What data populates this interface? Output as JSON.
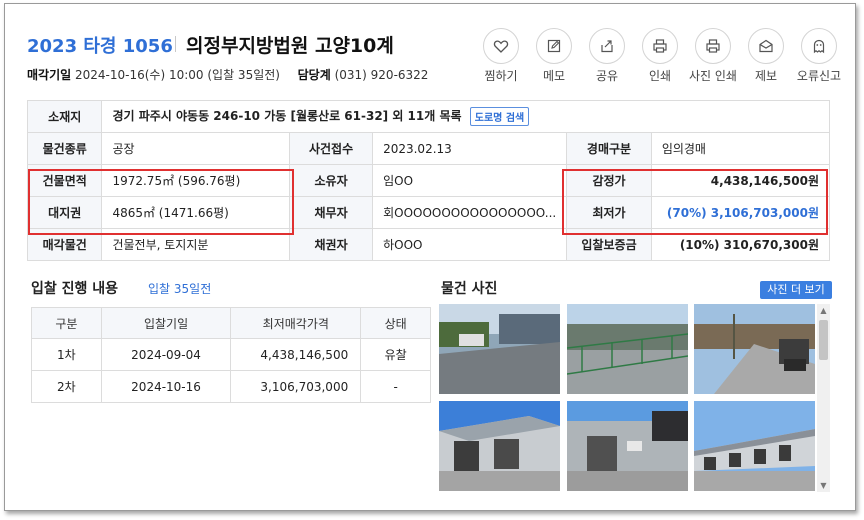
{
  "header": {
    "case_no": "2023 타경 1056",
    "court": "의정부지방법원 고양10계",
    "sale_date_label": "매각기일",
    "sale_date_value": "2024-10-16(수) 10:00 (입찰 35일전)",
    "manager_label": "담당계",
    "manager_value": "(031) 920-6322"
  },
  "actions": [
    {
      "label": "찜하기",
      "icon": "heart-icon"
    },
    {
      "label": "메모",
      "icon": "pencil-icon"
    },
    {
      "label": "공유",
      "icon": "share-icon"
    },
    {
      "label": "인쇄",
      "icon": "print-icon"
    },
    {
      "label": "사진 인쇄",
      "icon": "print-icon"
    },
    {
      "label": "제보",
      "icon": "envelope-icon"
    },
    {
      "label": "오류신고",
      "icon": "ghost-icon"
    }
  ],
  "info": {
    "location_label": "소재지",
    "location_value": "경기 파주시 야동동 246-10 가동 [월롱산로 61-32] 외 11개 목록",
    "road_btn": "도로명 검색",
    "type_label": "물건종류",
    "type_value": "공장",
    "received_label": "사건접수",
    "received_value": "2023.02.13",
    "auction_type_label": "경매구분",
    "auction_type_value": "임의경매",
    "building_area_label": "건물면적",
    "building_area_value": "1972.75㎡ (596.76평)",
    "owner_label": "소유자",
    "owner_value": "임OO",
    "appraisal_label": "감정가",
    "appraisal_value": "4,438,146,500원",
    "land_label": "대지권",
    "land_value": "4865㎡ (1471.66평)",
    "debtor_label": "채무자",
    "debtor_value": "회OOOOOOOOOOOOOOOO...",
    "min_price_label": "최저가",
    "min_price_value": "(70%) 3,106,703,000원",
    "sale_item_label": "매각물건",
    "sale_item_value": "건물전부, 토지지분",
    "creditor_label": "채권자",
    "creditor_value": "하OOO",
    "deposit_label": "입찰보증금",
    "deposit_value": "(10%) 310,670,300원"
  },
  "history": {
    "title": "입찰 진행 내용",
    "subtitle": "입찰 35일전",
    "columns": [
      "구분",
      "입찰기일",
      "최저매각가격",
      "상태"
    ],
    "rows": [
      [
        "1차",
        "2024-09-04",
        "4,438,146,500",
        "유찰"
      ],
      [
        "2차",
        "2024-10-16",
        "3,106,703,000",
        "-"
      ]
    ]
  },
  "photos": {
    "title": "물건 사진",
    "more": "사진 더 보기"
  },
  "colors": {
    "accent": "#2f6fd6",
    "highlight_border": "#e03030",
    "label_bg": "#f5f7fa"
  }
}
